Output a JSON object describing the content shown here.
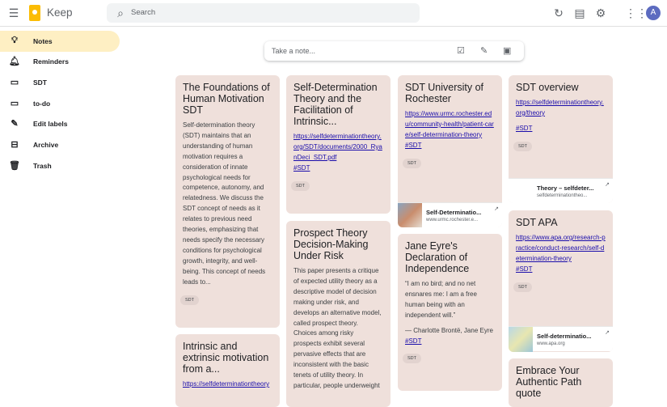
{
  "header": {
    "brand": "Keep",
    "search_placeholder": "Search",
    "avatar_letter": "A"
  },
  "sidebar": {
    "items": [
      {
        "label": "Notes",
        "icon": "lightbulb-icon",
        "active": true
      },
      {
        "label": "Reminders",
        "icon": "bell-icon"
      },
      {
        "label": "SDT",
        "icon": "label-icon"
      },
      {
        "label": "to-do",
        "icon": "label-icon"
      },
      {
        "label": "Edit labels",
        "icon": "pencil-icon"
      },
      {
        "label": "Archive",
        "icon": "archive-icon"
      },
      {
        "label": "Trash",
        "icon": "trash-icon"
      }
    ]
  },
  "take_note": {
    "placeholder": "Take a note..."
  },
  "notes": {
    "n1": {
      "title": "The Foundations of Human Motivation SDT",
      "body": "Self-determination theory (SDT) maintains that an understanding of human motivation requires a consideration of innate psychological needs for competence, autonomy, and relatedness. We discuss the SDT concept of needs as it relates to previous need theories, emphasizing that needs specify the necessary conditions for psychological growth, integrity, and well-being. This concept of needs leads to...",
      "label": "SDT"
    },
    "n2": {
      "title": "Intrinsic and extrinsic motivation from a...",
      "link": "https://selfdeterminationtheory"
    },
    "n3": {
      "title": "Self-Determination Theory and the Facilitation of Intrinsic...",
      "link": "https://selfdeterminationtheory.org/SDT/documents/2000_RyanDeci_SDT.pdf",
      "hashtag": "#SDT",
      "label": "SDT"
    },
    "n4": {
      "title": "Prospect Theory Decision-Making Under Risk",
      "body": "This paper presents a critique of expected utility theory as a descriptive model of decision making under risk, and develops an alternative model, called prospect theory. Choices among risky prospects exhibit several pervasive effects that are inconsistent with the basic tenets of utility theory. In particular, people underweight"
    },
    "n5": {
      "title": "SDT University of Rochester",
      "link": "https://www.urmc.rochester.edu/community-health/patient-care/self-determination-theory",
      "hashtag": "#SDT",
      "label": "SDT",
      "preview_title": "Self-Determinatio...",
      "preview_url": "www.urmc.rochester.e..."
    },
    "n6": {
      "title": "Jane Eyre's Declaration of Independence",
      "body": "“I am no bird; and no net ensnares me: I am a free human being with an independent will.”",
      "attribution": "— Charlotte Brontë, Jane Eyre",
      "hashtag": "#SDT",
      "label": "SDT"
    },
    "n7": {
      "title": "SDT overview",
      "link": "https://selfdeterminationtheory.org/theory",
      "hashtag": "#SDT",
      "label": "SDT",
      "preview_title": "Theory – selfdeter...",
      "preview_url": "selfdeterminationtheo..."
    },
    "n8": {
      "title": "SDT APA",
      "link": "https://www.apa.org/research-practice/conduct-research/self-determination-theory",
      "hashtag": "#SDT",
      "label": "SDT",
      "preview_title": "Self-determinatio...",
      "preview_url": "www.apa.org"
    },
    "n9": {
      "title": "Embrace Your Authentic Path quote"
    }
  }
}
